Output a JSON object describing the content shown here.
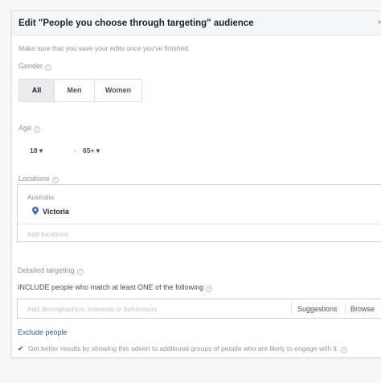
{
  "dialog": {
    "title": "Edit \"People you choose through targeting\" audience",
    "close": "×",
    "note": "Make sure that you save your edits once you've finished."
  },
  "gender": {
    "label": "Gender",
    "options": [
      "All",
      "Men",
      "Women"
    ],
    "selected": "All"
  },
  "age": {
    "label": "Age",
    "min": "18 ▾",
    "dash": "-",
    "max": "65+ ▾"
  },
  "locations": {
    "label": "Locations",
    "country": "Australia",
    "item": "Victoria",
    "add_placeholder": "Add locations"
  },
  "detailed_targeting": {
    "label": "Detailed targeting",
    "include_label": "INCLUDE people who match at least ONE of the following",
    "input_placeholder": "Add demographics, interests or behaviours",
    "suggestions": "Suggestions",
    "browse": "Browse"
  },
  "exclude": {
    "label": "Exclude people"
  },
  "expansion": {
    "checked": true,
    "check_glyph": "✔",
    "text": "Get better results by showing this advert to additional groups of people who are likely to engage with it."
  },
  "colors": {
    "link": "#365899",
    "muted": "#90949c",
    "border": "#ccd0d5"
  }
}
